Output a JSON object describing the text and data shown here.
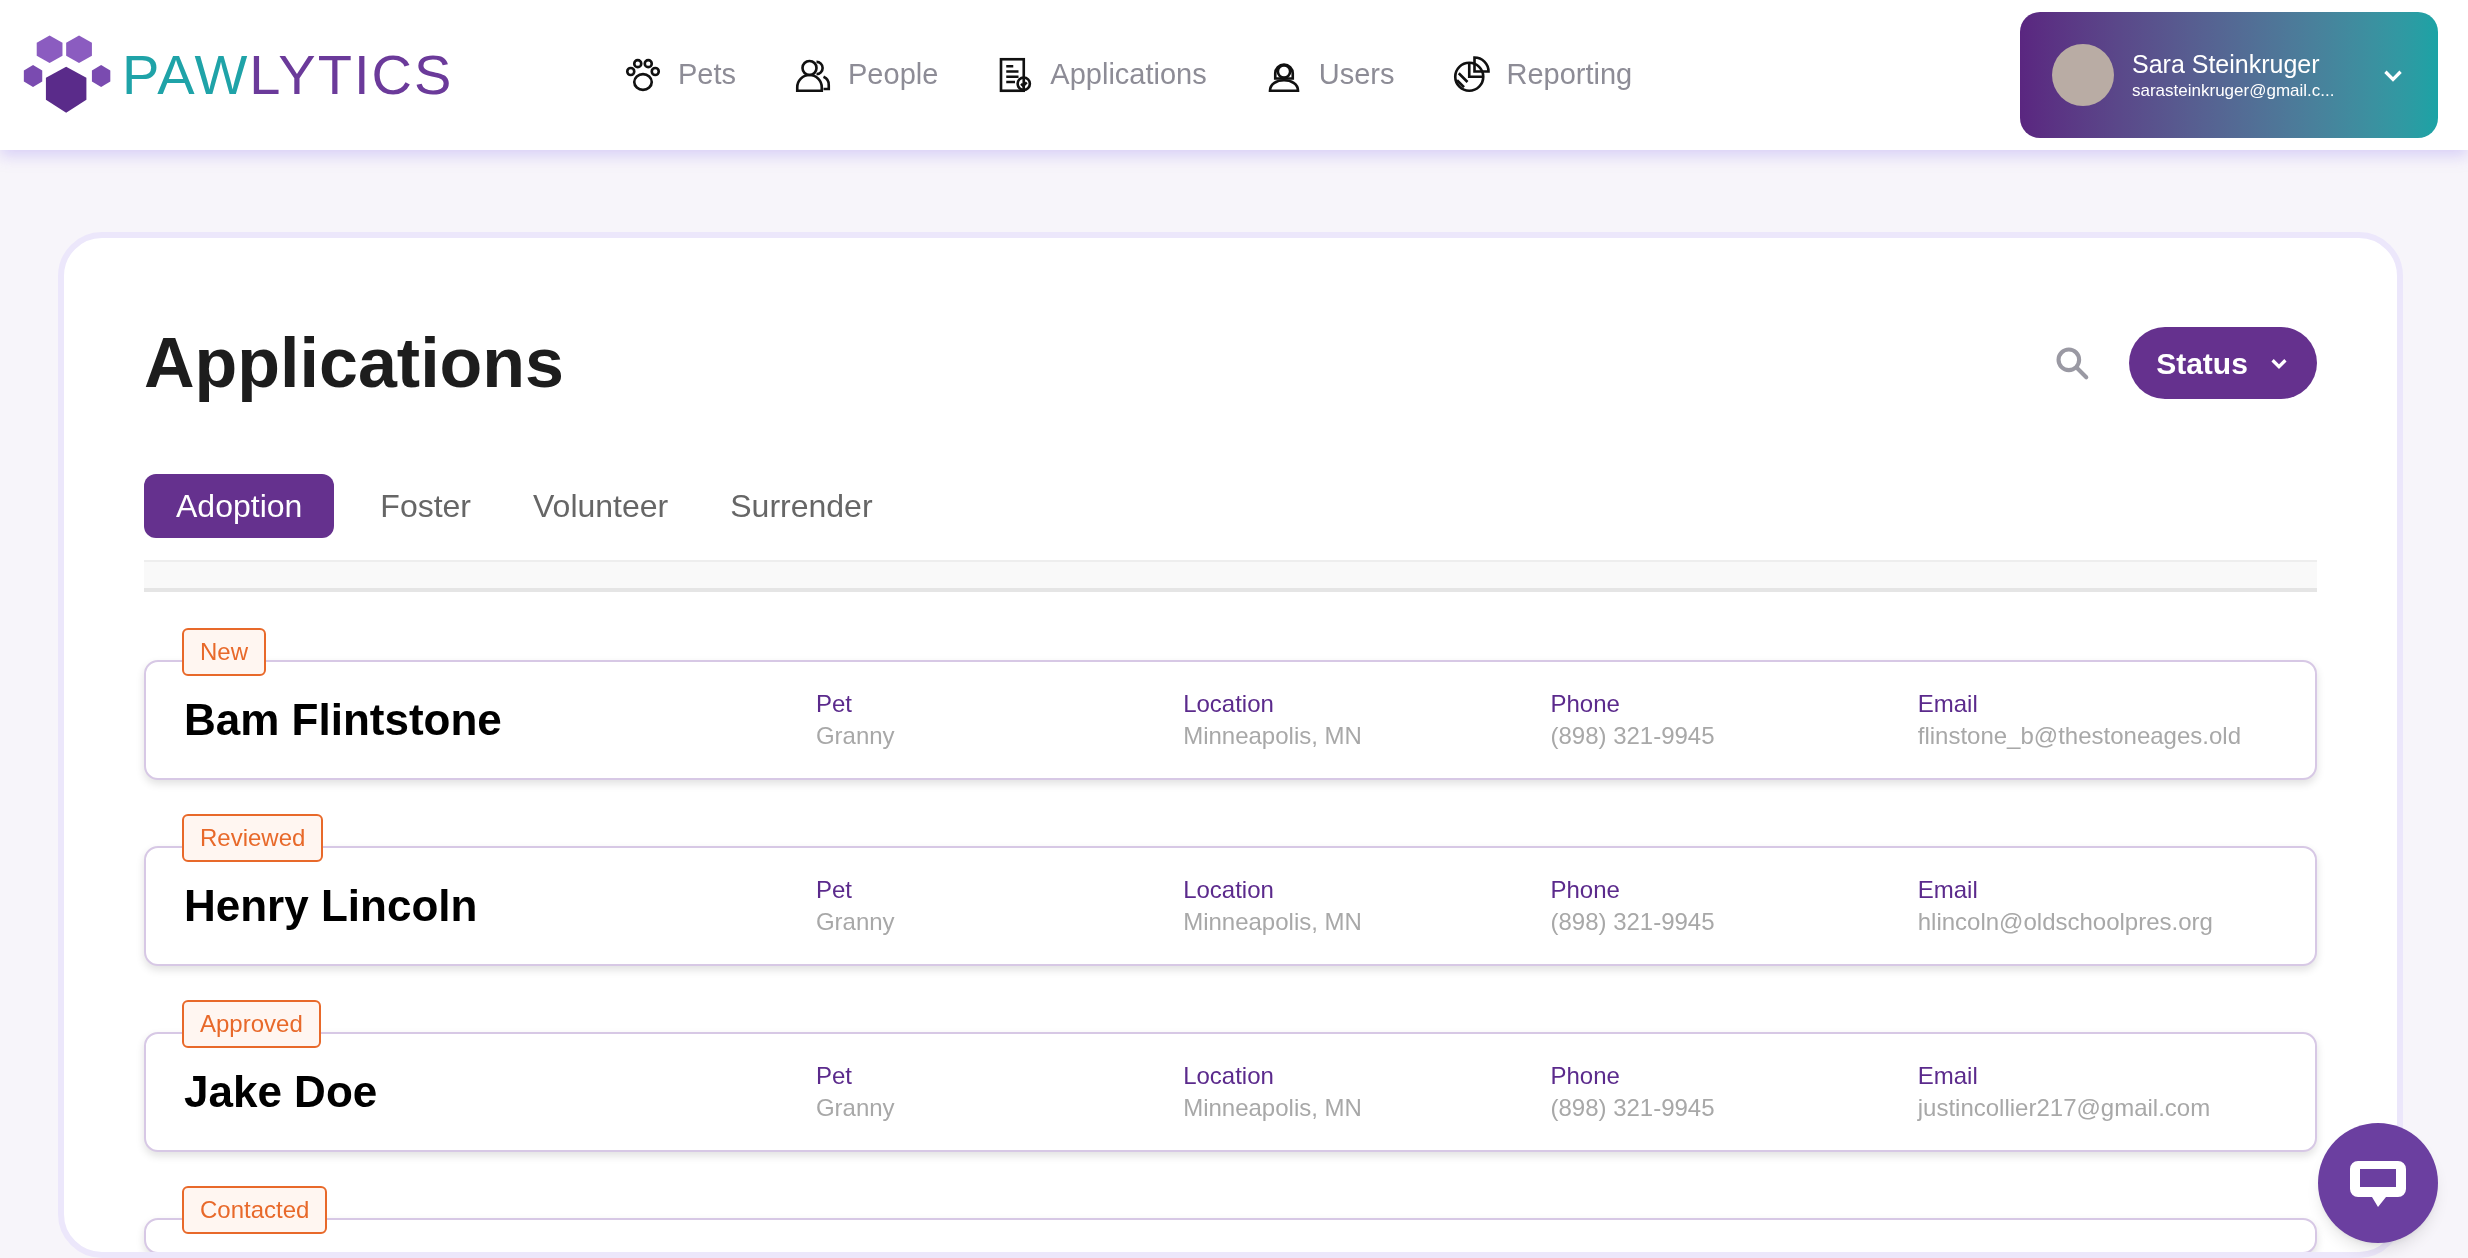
{
  "logo": {
    "parts": [
      {
        "text": "PAW",
        "color": "#1fa3a8"
      },
      {
        "text": "LYTICS",
        "color": "#6b3a9a"
      }
    ]
  },
  "nav": [
    {
      "label": "Pets",
      "kind": "paw"
    },
    {
      "label": "People",
      "kind": "people"
    },
    {
      "label": "Applications",
      "kind": "document"
    },
    {
      "label": "Users",
      "kind": "user"
    },
    {
      "label": "Reporting",
      "kind": "chart"
    }
  ],
  "user": {
    "name": "Sara Steinkruger",
    "email": "sarasteinkruger@gmail.c..."
  },
  "page": {
    "title": "Applications",
    "filter": "Status"
  },
  "tabs": [
    {
      "label": "Adoption",
      "selected": true
    },
    {
      "label": "Foster",
      "selected": false
    },
    {
      "label": "Volunteer",
      "selected": false
    },
    {
      "label": "Surrender",
      "selected": false
    }
  ],
  "applications": [
    {
      "status": "New",
      "name": "Bam Flintstone",
      "fields": [
        {
          "label": "Pet",
          "value": "Granny"
        },
        {
          "label": "Location",
          "value": "Minneapolis, MN"
        },
        {
          "label": "Phone",
          "value": "(898) 321-9945"
        },
        {
          "label": "Email",
          "value": "flinstone_b@thestoneages.old"
        }
      ]
    },
    {
      "status": "Reviewed",
      "name": "Henry Lincoln",
      "fields": [
        {
          "label": "Pet",
          "value": "Granny"
        },
        {
          "label": "Location",
          "value": "Minneapolis, MN"
        },
        {
          "label": "Phone",
          "value": "(898) 321-9945"
        },
        {
          "label": "Email",
          "value": "hlincoln@oldschoolpres.org"
        }
      ]
    },
    {
      "status": "Approved",
      "name": "Jake Doe",
      "fields": [
        {
          "label": "Pet",
          "value": "Granny"
        },
        {
          "label": "Location",
          "value": "Minneapolis, MN"
        },
        {
          "label": "Phone",
          "value": "(898) 321-9945"
        },
        {
          "label": "Email",
          "value": "justincollier217@gmail.com"
        }
      ]
    },
    {
      "status": "Contacted"
    }
  ]
}
